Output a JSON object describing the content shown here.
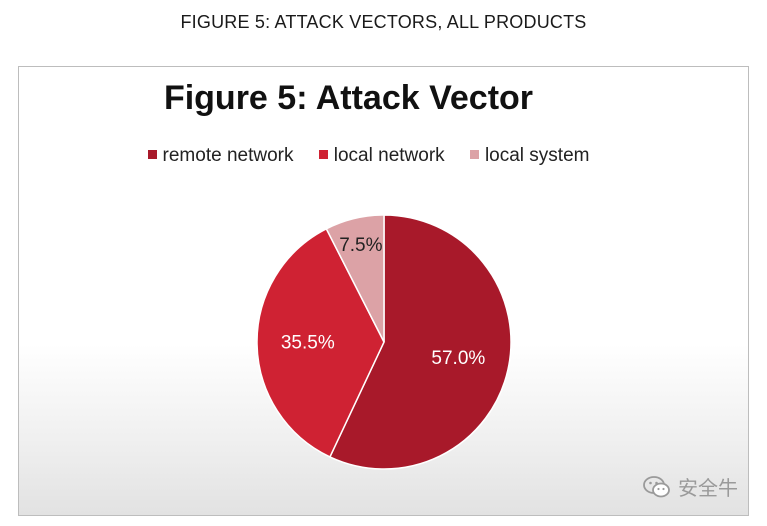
{
  "caption": "FIGURE 5: ATTACK VECTORS, ALL PRODUCTS",
  "watermark": "安全牛",
  "chart_data": {
    "type": "pie",
    "title": "Figure 5: Attack Vector",
    "legend_position": "top",
    "slices": [
      {
        "label": "remote network",
        "value": 57.0,
        "display": "57.0%",
        "color": "#a8192a"
      },
      {
        "label": "local network",
        "value": 35.5,
        "display": "35.5%",
        "color": "#cf2233"
      },
      {
        "label": "local system",
        "value": 7.5,
        "display": "7.5%",
        "color": "#dca2a6"
      }
    ]
  }
}
